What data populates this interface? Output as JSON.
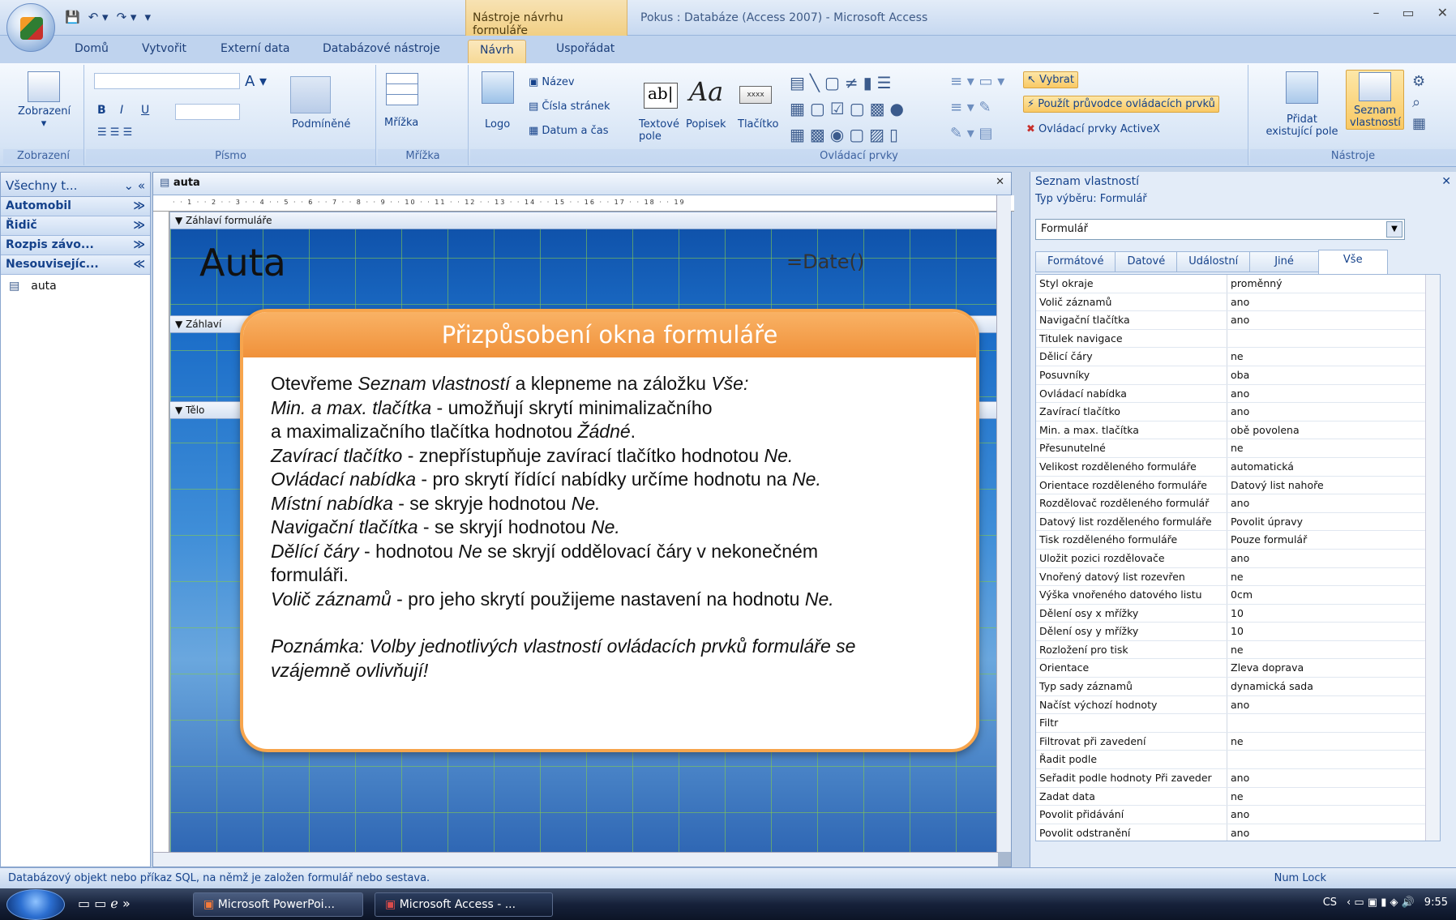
{
  "app": {
    "context_tab_title": "Nástroje návrhu formuláře",
    "window_title": "Pokus : Databáze (Access 2007) - Microsoft Access",
    "controls": [
      "–",
      "▭",
      "✕"
    ]
  },
  "tabs": [
    "Domů",
    "Vytvořit",
    "Externí data",
    "Databázové nástroje",
    "Návrh",
    "Uspořádat"
  ],
  "ribbon": {
    "groups": {
      "zobrazeni": {
        "label": "Zobrazení",
        "button": "Zobrazení"
      },
      "pismo": {
        "label": "Písmo",
        "podminene": "Podmíněné"
      },
      "mrizka": {
        "label": "Mřížka",
        "button": "Mřížka"
      },
      "ovladaci": {
        "label": "Ovládací prvky",
        "logo": "Logo",
        "nazev": "Název",
        "cisla_stranek": "Čísla stránek",
        "datum_cas": "Datum a čas",
        "textove_pole": "Textové pole",
        "textove_pole_line1": "Textové",
        "textove_pole_line2": "pole",
        "popisek": "Popisek",
        "tlacitko": "Tlačítko",
        "vybrat": "Vybrat",
        "pruvodce": "Použít průvodce ovládacích prvků",
        "activex": "Ovládací prvky ActiveX"
      },
      "nastroje": {
        "label": "Nástroje",
        "pridat_line1": "Přidat",
        "pridat_line2": "existující pole",
        "seznam_line1": "Seznam",
        "seznam_line2": "vlastností"
      }
    }
  },
  "nav": {
    "header": "Všechny t...",
    "groups": [
      "Automobil",
      "Řidič",
      "Rozpis závo...",
      "Nesouvisejíc..."
    ],
    "items": [
      "auta"
    ]
  },
  "designer": {
    "doc_tab": "auta",
    "sections": [
      "Záhlaví formuláře",
      "Záhlaví",
      "Tělo"
    ],
    "form_title": "Auta",
    "date_field": "=Date()"
  },
  "propsheet": {
    "title": "Seznam vlastností",
    "selection_type": "Typ výběru:  Formulář",
    "combo_value": "Formulář",
    "tabs": [
      "Formátové",
      "Datové",
      "Událostní",
      "Jiné",
      "Vše"
    ],
    "rows": [
      [
        "Styl okraje",
        "proměnný"
      ],
      [
        "Volič záznamů",
        "ano"
      ],
      [
        "Navigační tlačítka",
        "ano"
      ],
      [
        "Titulek navigace",
        ""
      ],
      [
        "Dělicí čáry",
        "ne"
      ],
      [
        "Posuvníky",
        "oba"
      ],
      [
        "Ovládací nabídka",
        "ano"
      ],
      [
        "Zavírací tlačítko",
        "ano"
      ],
      [
        "Min. a max. tlačítka",
        "obě povolena"
      ],
      [
        "Přesunutelné",
        "ne"
      ],
      [
        "Velikost rozděleného formuláře",
        "automatická"
      ],
      [
        "Orientace rozděleného formuláře",
        "Datový list nahoře"
      ],
      [
        "Rozdělovač rozděleného formulář",
        "ano"
      ],
      [
        "Datový list rozděleného formuláře",
        "Povolit úpravy"
      ],
      [
        "Tisk rozděleného formuláře",
        "Pouze formulář"
      ],
      [
        "Uložit pozici rozdělovače",
        "ano"
      ],
      [
        "Vnořený datový list rozevřen",
        "ne"
      ],
      [
        "Výška vnořeného datového listu",
        "0cm"
      ],
      [
        "Dělení osy x mřížky",
        "10"
      ],
      [
        "Dělení osy y mřížky",
        "10"
      ],
      [
        "Rozložení pro tisk",
        "ne"
      ],
      [
        "Orientace",
        "Zleva doprava"
      ],
      [
        "Typ sady záznamů",
        "dynamická sada"
      ],
      [
        "Načíst výchozí hodnoty",
        "ano"
      ],
      [
        "Filtr",
        ""
      ],
      [
        "Filtrovat při zavedení",
        "ne"
      ],
      [
        "Řadit podle",
        ""
      ],
      [
        "Seřadit podle hodnoty Při zaveder",
        "ano"
      ],
      [
        "Zadat data",
        "ne"
      ],
      [
        "Povolit přidávání",
        "ano"
      ],
      [
        "Povolit odstranění",
        "ano"
      ]
    ]
  },
  "status": {
    "text": "Databázový objekt nebo příkaz SQL, na němž je založen formulář nebo sestava.",
    "numlock": "Num Lock"
  },
  "taskbar": {
    "tasks": [
      "Microsoft PowerPoi...",
      "Microsoft Access - ..."
    ],
    "lang": "CS",
    "time": "9:55"
  },
  "callout": {
    "title": "Přizpůsobení okna  formuláře",
    "lines": [
      [
        [
          "Otevřeme ",
          false
        ],
        [
          "Seznam vlastností",
          true
        ],
        [
          " a klepneme na záložku ",
          false
        ],
        [
          "Vše:",
          true
        ]
      ],
      [
        [
          "Min. a max. tlačítka",
          true
        ],
        [
          " - umožňují skrytí minimalizačního",
          false
        ]
      ],
      [
        [
          "a maximalizačního tlačítka hodnotou ",
          false
        ],
        [
          "Žádné",
          true
        ],
        [
          ".",
          false
        ]
      ],
      [
        [
          "Zavírací tlačítko",
          true
        ],
        [
          " - znepřístupňuje zavírací tlačítko hodnotou ",
          false
        ],
        [
          "Ne.",
          true
        ]
      ],
      [
        [
          "Ovládací nabídka",
          true
        ],
        [
          " - pro skrytí řídící nabídky určíme hodnotu na ",
          false
        ],
        [
          "Ne.",
          true
        ]
      ],
      [
        [
          "Místní nabídka",
          true
        ],
        [
          " - se skryje hodnotou ",
          false
        ],
        [
          "Ne.",
          true
        ]
      ],
      [
        [
          "Navigační tlačítka",
          true
        ],
        [
          " - se skryjí hodnotou ",
          false
        ],
        [
          "Ne.",
          true
        ]
      ],
      [
        [
          "Dělící čáry",
          true
        ],
        [
          " - hodnotou ",
          false
        ],
        [
          "Ne",
          true
        ],
        [
          " se skryjí oddělovací čáry v nekonečném",
          false
        ]
      ],
      [
        [
          "formuláři.",
          false
        ]
      ],
      [
        [
          "Volič záznamů",
          true
        ],
        [
          " - pro jeho skrytí použijeme nastavení na hodnotu ",
          false
        ],
        [
          "Ne.",
          true
        ]
      ],
      [
        [
          "",
          false
        ]
      ],
      [
        [
          "Poznámka: Volby jednotlivých vlastností ovládacích prvků formuláře se",
          true
        ]
      ],
      [
        [
          "vzájemně ovlivňují!",
          true
        ]
      ]
    ]
  }
}
